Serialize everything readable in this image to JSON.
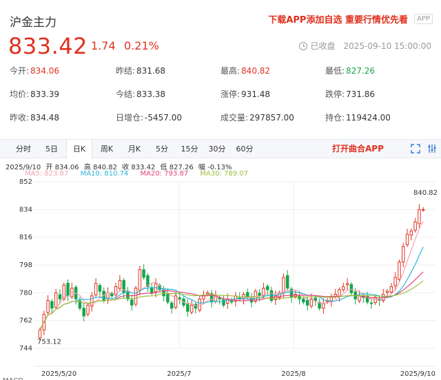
{
  "header": {
    "title": "沪金主力",
    "promo": "下载APP添加自选 重要行情优先看",
    "app_badge": "APP",
    "price": "833.42",
    "change": "1.74",
    "change_pct": "0.21%",
    "status_label": "已收盘",
    "datetime": "2025-09-10 15:00:00"
  },
  "stats": [
    [
      {
        "k": "今开:",
        "v": "834.06",
        "c": "up"
      },
      {
        "k": "昨结:",
        "v": "831.68",
        "c": ""
      },
      {
        "k": "最高:",
        "v": "840.82",
        "c": "up"
      },
      {
        "k": "最低:",
        "v": "827.26",
        "c": "down"
      }
    ],
    [
      {
        "k": "均价:",
        "v": "833.39",
        "c": ""
      },
      {
        "k": "今结:",
        "v": "833.38",
        "c": ""
      },
      {
        "k": "涨停:",
        "v": "931.48",
        "c": ""
      },
      {
        "k": "跌停:",
        "v": "731.86",
        "c": ""
      }
    ],
    [
      {
        "k": "昨收:",
        "v": "834.48",
        "c": ""
      },
      {
        "k": "日增仓:",
        "v": "-5457.00",
        "c": ""
      },
      {
        "k": "成交量:",
        "v": "297857.00",
        "c": ""
      },
      {
        "k": "持仓:",
        "v": "119424.00",
        "c": ""
      }
    ]
  ],
  "tabs": [
    "分时",
    "5日",
    "日K",
    "周K",
    "月K",
    "5分",
    "15分",
    "30分",
    "60分"
  ],
  "active_tab": "日K",
  "open_app": "打开曲合APP",
  "icons": [
    "fullscreen-icon",
    "settings-icon"
  ],
  "info_line": {
    "date": "2025/9/10",
    "open": "开 834.06",
    "high": "高 840.82",
    "close": "收 833.42",
    "low": "低 827.26",
    "amp": "幅 -0.13%"
  },
  "ma": [
    {
      "label": "MA5: 823.87",
      "color": "#f4a3b4"
    },
    {
      "label": "MA10: 810.74",
      "color": "#29b6d8"
    },
    {
      "label": "MA20: 793.87",
      "color": "#e2457a"
    },
    {
      "label": "MA30: 789.07",
      "color": "#9cbf3c"
    }
  ],
  "colors": {
    "up": "#e0301e",
    "down": "#14a64a",
    "accent": "#e0301e"
  },
  "chart_data": {
    "type": "candlestick",
    "y_ticks": [
      "852",
      "834",
      "816",
      "798",
      "780",
      "762",
      "744"
    ],
    "ylim": [
      744,
      852
    ],
    "x_ticks": [
      "2025/5/20",
      "2025/7",
      "2025/8",
      "2025/9/10"
    ],
    "max_label": "840.82",
    "min_label": "753.12",
    "closes": [
      756,
      766,
      775,
      770,
      780,
      776,
      785,
      778,
      783,
      776,
      770,
      765,
      772,
      778,
      786,
      781,
      775,
      780,
      778,
      784,
      788,
      780,
      776,
      772,
      783,
      795,
      790,
      784,
      780,
      786,
      782,
      778,
      774,
      770,
      778,
      776,
      772,
      768,
      772,
      770,
      776,
      778,
      780,
      774,
      778,
      776,
      772,
      776,
      774,
      778,
      776,
      779,
      777,
      774,
      781,
      778,
      783,
      782,
      775,
      778,
      780,
      790,
      783,
      777,
      779,
      776,
      774,
      772,
      776,
      775,
      770,
      773,
      775,
      777,
      779,
      782,
      784,
      786,
      780,
      776,
      778,
      777,
      774,
      773,
      777,
      775,
      779,
      781,
      784,
      790,
      800,
      810,
      818,
      820,
      826,
      834,
      834
    ]
  },
  "macd_label": "MACD"
}
